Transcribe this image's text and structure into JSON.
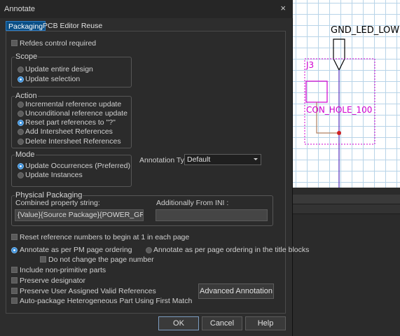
{
  "dialog": {
    "title": "Annotate",
    "close_glyph": "×",
    "tabs": [
      {
        "label": "Packaging",
        "active": true
      },
      {
        "label": "PCB Editor Reuse",
        "active": false
      }
    ],
    "refdes_control_label": "Refdes control required",
    "scope": {
      "title": "Scope",
      "options": [
        {
          "label": "Update entire design",
          "selected": false
        },
        {
          "label": "Update selection",
          "selected": true
        }
      ]
    },
    "action": {
      "title": "Action",
      "options": [
        {
          "label": "Incremental reference update",
          "selected": false
        },
        {
          "label": "Unconditional reference update",
          "selected": false
        },
        {
          "label": "Reset part references to \"?\"",
          "selected": true
        },
        {
          "label": "Add Intersheet References",
          "selected": false
        },
        {
          "label": "Delete Intersheet References",
          "selected": false
        }
      ]
    },
    "mode": {
      "title": "Mode",
      "options": [
        {
          "label": "Update Occurrences (Preferred)",
          "selected": true
        },
        {
          "label": "Update Instances",
          "selected": false
        }
      ]
    },
    "annotation_type": {
      "label": "Annotation Type",
      "value": "Default"
    },
    "physical_packaging": {
      "title": "Physical Packaging",
      "combined_label": "Combined property string:",
      "combined_value": "{Value}{Source Package}{POWER_GROUP}",
      "ini_label": "Additionally From INI :",
      "ini_value": ""
    },
    "reset_numbers_label": "Reset reference numbers to begin at 1 in each page",
    "ordering": {
      "pm_label": "Annotate as per PM page ordering",
      "title_block_label": "Annotate as per page ordering in the title blocks",
      "no_change_label": "Do not change the page number"
    },
    "checks": [
      {
        "label": "Include non-primitive parts"
      },
      {
        "label": "Preserve designator"
      },
      {
        "label": "Preserve User Assigned Valid References"
      },
      {
        "label": "Auto-package Heterogeneous Part Using First Match"
      }
    ],
    "advanced_label": "Advanced Annotation",
    "buttons": {
      "ok": "OK",
      "cancel": "Cancel",
      "help": "Help"
    }
  },
  "schematic": {
    "net_name": "GND_LED_LOW",
    "refdes": "J3",
    "value": "CON_HOLE_100",
    "wire_color": "#6a4bc4",
    "outline_color": "#d000d0",
    "pin_color": "#d02020"
  }
}
